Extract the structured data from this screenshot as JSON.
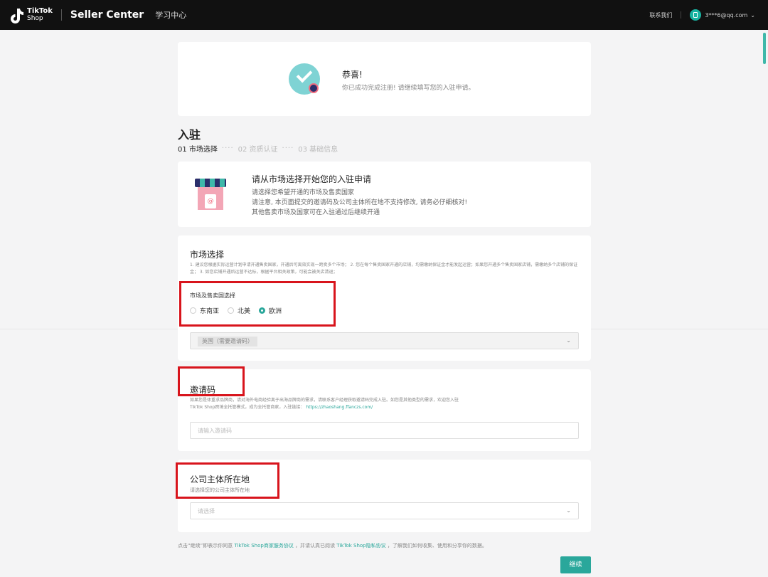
{
  "topbar": {
    "logo_text": "TikTok",
    "logo_sub": "Shop",
    "brand": "Seller Center",
    "learning": "学习中心",
    "contact": "联系我们",
    "account": "3***6@qq.com"
  },
  "success": {
    "title": "恭喜!",
    "subtitle": "你已成功完成注册! 请继续填写您的入驻申请。"
  },
  "page": {
    "title": "入驻",
    "steps": [
      "01 市场选择",
      "02 资质认证",
      "03 基础信息"
    ]
  },
  "intro": {
    "title": "请从市场选择开始您的入驻申请",
    "lines": [
      "请选择您希望开通的市场及售卖国家",
      "请注意, 本页面提交的邀请码及公司主体所在地不支持修改, 请务必仔细核对!",
      "其他售卖市场及国家可在入驻通过后继续开通"
    ]
  },
  "market": {
    "title": "市场选择",
    "desc": "1. 建议您根据实际运营计划申请开通售卖国家，开通后可离效实现一跨卖多个市场； 2. 您在每个售卖国家开通的店铺，均需缴纳保证金才能发起运营；如果您开通多个售卖国家店铺，需缴纳多个店铺的保证金； 3. 如您店铺开通后运营不达标，根据平台相关政策，可能会被关店清退；",
    "field_label": "市场及售卖国选择",
    "options": [
      "东南亚",
      "北美",
      "欧洲"
    ],
    "selected": "欧洲",
    "country_chip": "英国（需要邀请码）"
  },
  "invite": {
    "title": "邀请码",
    "desc_1": "如果您是体重求品牌商，请对海外电商经验离于出海品牌商的需求，请联系客户经理获取邀请码完成入驻。如您是其他类型的需求，欢迎您入驻",
    "desc_2": "TikTok Shop跨境全托管模式，成为全托管商家，入驻链接：",
    "link": "https://zhaoshang.ffanczs.com/",
    "placeholder": "请输入邀请码"
  },
  "company": {
    "title": "公司主体所在地",
    "subtitle": "请选择您的公司主体所在地",
    "placeholder": "请选择"
  },
  "footer": {
    "prefix": "点击“继续”即表示你同意",
    "agreement": "TikTok Shop商家服务协议",
    "middle": "，并请认真已阅读",
    "privacy": "TikTok Shop隐私协议",
    "suffix": "，了解我们如何收集、使用和分享你的数据。",
    "next_button": "继续"
  }
}
